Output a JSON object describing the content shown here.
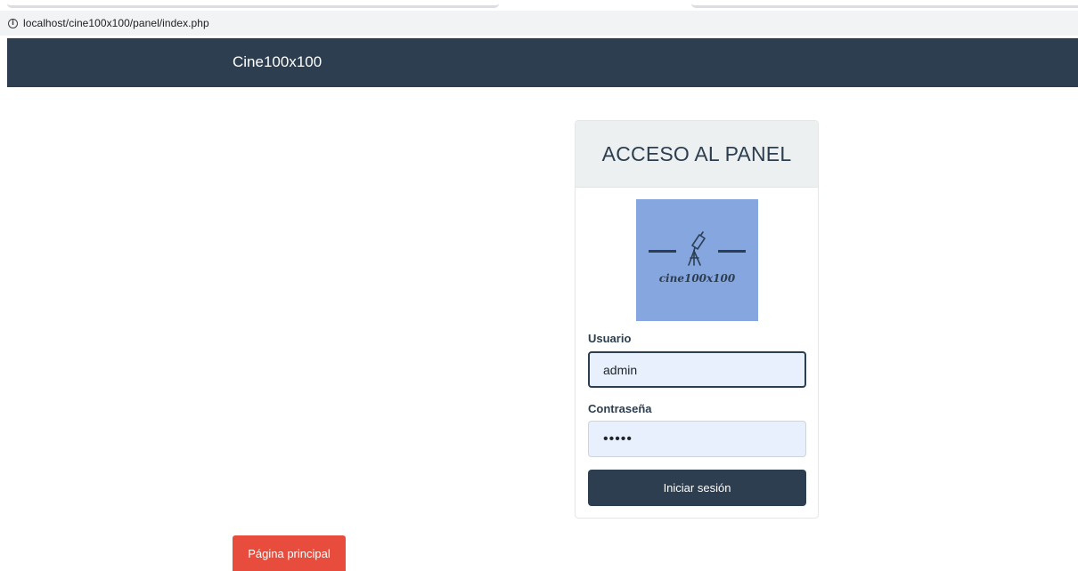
{
  "browser": {
    "url": "localhost/cine100x100/panel/index.php",
    "info_icon": "info-icon"
  },
  "navbar": {
    "brand": "Cine100x100",
    "color": "#2c3e50"
  },
  "login": {
    "title": "ACCESO AL PANEL",
    "logo_text": "cine100x100",
    "logo_icon": "telescope-icon",
    "username_label": "Usuario",
    "username_value": "admin",
    "password_label": "Contraseña",
    "password_value": "•••••",
    "submit_label": "Iniciar sesión"
  },
  "footer": {
    "home_button": "Página principal",
    "home_color": "#e74c3c"
  }
}
